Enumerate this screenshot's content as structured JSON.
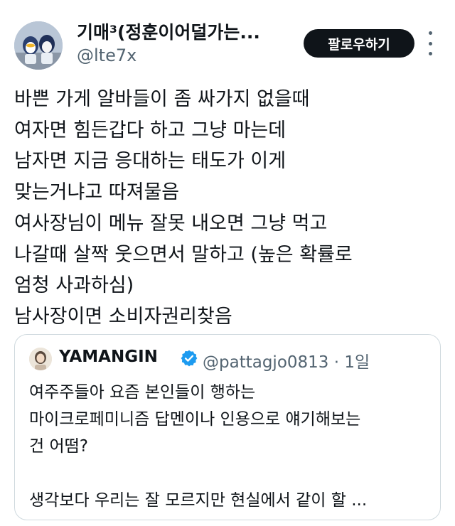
{
  "author": {
    "display_name": "기매³(정훈이어덜가는...",
    "handle": "@lte7x",
    "avatar_icon": "mascot-avatar-icon"
  },
  "follow_button": {
    "label": "팔로우하기"
  },
  "more_icon": "more-vertical-icon",
  "tweet_lines": [
    "바쁜 가게 알바들이 좀 싸가지 없을때",
    "여자면 힘든갑다 하고 그냥 마는데",
    "남자면 지금 응대하는 태도가 이게",
    "맞는거냐고 따져물음",
    "여사장님이 메뉴 잘못 내오면 그냥 먹고",
    "나갈때 살짝 웃으면서 말하고 (높은 확률로",
    "엄청 사과하심)",
    "남사장이면 소비자권리찾음"
  ],
  "quoted_tweet": {
    "display_name": "YAMANGIN",
    "verified_icon": "verified-badge-icon",
    "handle_time": "@pattagjo0813 · 1일",
    "lines": [
      "여주주들아 요즘 본인들이 행하는",
      "마이크로페미니즘 답멘이나 인용으로 얘기해보는",
      "건 어떰?",
      "",
      "생각보다 우리는 잘 모르지만 현실에서 같이 할 ..."
    ]
  },
  "colors": {
    "text_primary": "#0f1419",
    "text_secondary": "#536471",
    "button_bg": "#0f1419",
    "verified": "#1d9bf0",
    "border": "#cfd9de"
  }
}
